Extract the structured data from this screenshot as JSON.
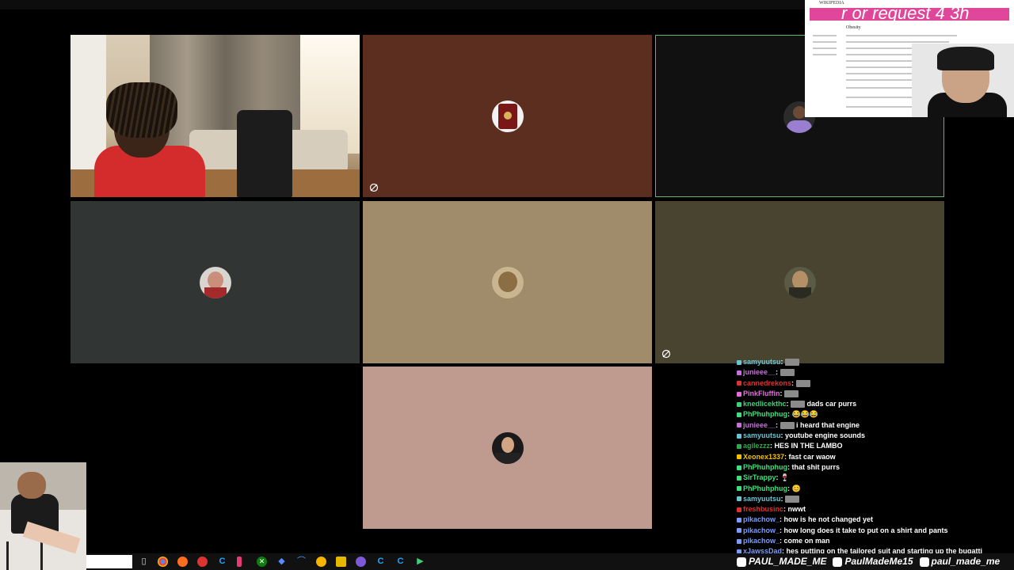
{
  "overlay": {
    "banner_text": "r or request 4 3h",
    "logo_text": "WIKIPEDIA",
    "article_title": "Obesity"
  },
  "chat": [
    {
      "user": "samyuutsu",
      "color": "#6bc4d6",
      "text": "",
      "emote": true
    },
    {
      "user": "junieee__",
      "color": "#c86fdc",
      "text": "",
      "emote": true
    },
    {
      "user": "cannedrekons",
      "color": "#e23030",
      "text": "",
      "emote": true
    },
    {
      "user": "PinkFluffin",
      "color": "#e86ce0",
      "text": "",
      "emote": true
    },
    {
      "user": "knedlicekthc",
      "color": "#3fd07c",
      "text": "dads car purrs",
      "emote": true
    },
    {
      "user": "PhPhuhphug",
      "color": "#3ee07a",
      "text": "😂😂😂",
      "emote": false
    },
    {
      "user": "junieee__",
      "color": "#c86fdc",
      "text": "i heard that engine",
      "emote": true
    },
    {
      "user": "samyuutsu",
      "color": "#6bc4d6",
      "text": "youtube engine sounds",
      "emote": false
    },
    {
      "user": "agilezzz",
      "color": "#2fa84f",
      "text": "HES IN THE LAMBO",
      "emote": false
    },
    {
      "user": "Xeonex1337",
      "color": "#f2c200",
      "text": "fast car waow",
      "emote": false
    },
    {
      "user": "PhPhuhphug",
      "color": "#3ee07a",
      "text": "that shit purrs",
      "emote": false
    },
    {
      "user": "SirTrappy",
      "color": "#3ee07a",
      "text": "🍷",
      "emote": false
    },
    {
      "user": "PhPhuhphug",
      "color": "#3ee07a",
      "text": "😊",
      "emote": false
    },
    {
      "user": "samyuutsu",
      "color": "#6bc4d6",
      "text": "",
      "emote": true
    },
    {
      "user": "freshbusinc",
      "color": "#e23030",
      "text": "nwwt",
      "emote": false
    },
    {
      "user": "pikachow_",
      "color": "#7a9cff",
      "text": "how is he not changed yet",
      "emote": false
    },
    {
      "user": "pikachow_",
      "color": "#7a9cff",
      "text": "how long does it take to put on a shirt and pants",
      "emote": false
    },
    {
      "user": "pikachow_",
      "color": "#7a9cff",
      "text": "come on man",
      "emote": false
    },
    {
      "user": "xJawssDad",
      "color": "#7a9cff",
      "text": "hes putting on the tailored suit and starting up the bugatti",
      "emote": false
    }
  ],
  "socials": [
    {
      "icon": "x-icon",
      "text": "PAUL_MADE_ME"
    },
    {
      "icon": "x-icon",
      "text": "PaulMadeMe15"
    },
    {
      "icon": "instagram-icon",
      "text": "paul_made_me"
    }
  ],
  "colors": {
    "tile_brown": "#5c2e20",
    "tile_dark": "#111111",
    "tile_slate": "#313634",
    "tile_tan": "#a08b6a",
    "tile_olive": "#48442f",
    "tile_pink": "#bf9b8f",
    "speaking_outline": "#5fb86a"
  }
}
